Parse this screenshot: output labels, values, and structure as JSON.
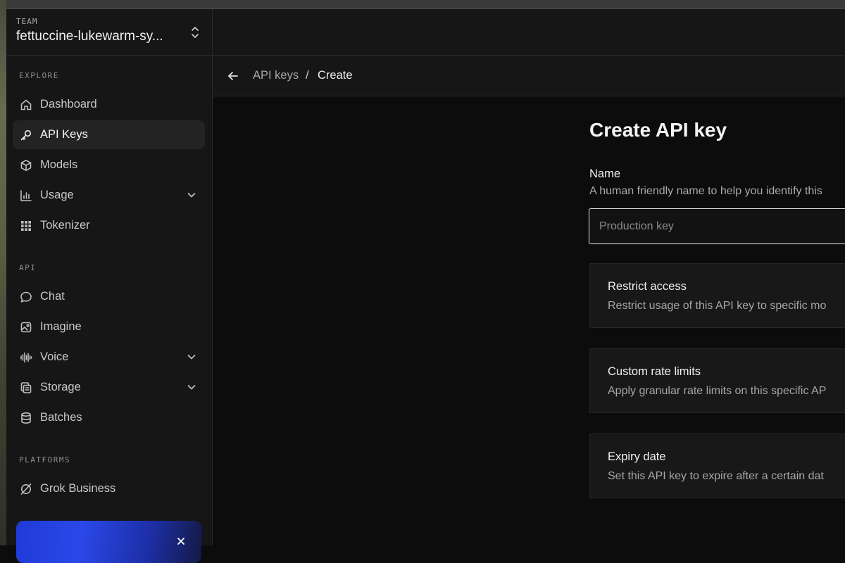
{
  "sidebar": {
    "team_label": "TEAM",
    "team_name": "fettuccine-lukewarm-sy...",
    "sections": {
      "explore": "EXPLORE",
      "api": "API",
      "platforms": "PLATFORMS"
    },
    "items": {
      "dashboard": {
        "label": "Dashboard",
        "icon": "home-icon"
      },
      "api_keys": {
        "label": "API Keys",
        "icon": "key-icon",
        "active": true
      },
      "models": {
        "label": "Models",
        "icon": "cube-icon"
      },
      "usage": {
        "label": "Usage",
        "icon": "bar-chart-icon"
      },
      "tokenizer": {
        "label": "Tokenizer",
        "icon": "grid-icon"
      },
      "chat": {
        "label": "Chat",
        "icon": "chat-bubble-icon"
      },
      "imagine": {
        "label": "Imagine",
        "icon": "image-icon"
      },
      "voice": {
        "label": "Voice",
        "icon": "waveform-icon"
      },
      "storage": {
        "label": "Storage",
        "icon": "files-icon"
      },
      "batches": {
        "label": "Batches",
        "icon": "database-icon"
      },
      "grok_business": {
        "label": "Grok Business",
        "icon": "grok-logo-icon"
      }
    }
  },
  "breadcrumb": {
    "parent": "API keys",
    "separator": "/",
    "current": "Create"
  },
  "form": {
    "title": "Create API key",
    "name_label": "Name",
    "name_help": "A human friendly name to help you identify this",
    "name_value": "",
    "name_placeholder": "Production key",
    "options": {
      "restrict": {
        "title": "Restrict access",
        "desc": "Restrict usage of this API key to specific mo"
      },
      "rate_limits": {
        "title": "Custom rate limits",
        "desc": "Apply granular rate limits on this specific AP"
      },
      "expiry": {
        "title": "Expiry date",
        "desc": "Set this API key to expire after a certain dat"
      }
    }
  },
  "colors": {
    "background": "#0c0c0c",
    "sidebar": "#161616",
    "active_item": "#232323",
    "card": "#181818",
    "promo_blue": "#2a48e8"
  }
}
